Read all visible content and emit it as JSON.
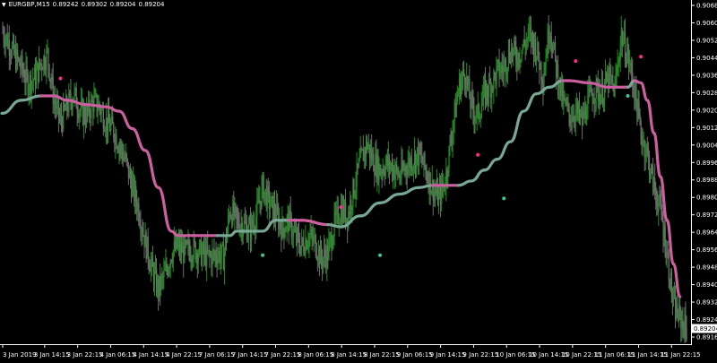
{
  "header": {
    "caret": "▼",
    "symbol": "EURGBP,M15",
    "o": "0.89242",
    "h": "0.89302",
    "l": "0.89204",
    "c": "0.89204"
  },
  "colors": {
    "background": "#000000",
    "axis": "#ffffff",
    "bull": "#228b22",
    "bear": "#6e6e6e",
    "ma_down": "#cc5fa0",
    "ma_up": "#77a894",
    "dot_sell": "#ff2d8a",
    "dot_buy": "#3cc98c"
  },
  "chart_data": {
    "type": "line",
    "title": "EURGBP,M15",
    "ylim": [
      0.89165,
      0.90685
    ],
    "y_ticks": [
      "0.90685",
      "0.90605",
      "0.90525",
      "0.90445",
      "0.90365",
      "0.90285",
      "0.90205",
      "0.90125",
      "0.90045",
      "0.89965",
      "0.89885",
      "0.89805",
      "0.89725",
      "0.89645",
      "0.89565",
      "0.89485",
      "0.89405",
      "0.89325",
      "0.89245",
      "0.89165"
    ],
    "x_ticks": [
      "3 Jan 2019",
      "3 Jan 14:15",
      "3 Jan 22:15",
      "4 Jan 06:15",
      "4 Jan 14:15",
      "4 Jan 22:15",
      "7 Jan 06:15",
      "7 Jan 14:15",
      "7 Jan 22:15",
      "8 Jan 06:15",
      "8 Jan 14:15",
      "8 Jan 22:15",
      "9 Jan 06:15",
      "9 Jan 14:15",
      "9 Jan 22:15",
      "10 Jan 06:15",
      "10 Jan 14:15",
      "10 Jan 22:15",
      "11 Jan 06:15",
      "11 Jan 14:15",
      "11 Jan 22:15"
    ],
    "current_price": "0.89204",
    "price_series": [
      {
        "bar": 0,
        "close": 0.9057
      },
      {
        "bar": 1,
        "close": 0.9052
      },
      {
        "bar": 2,
        "close": 0.9045
      },
      {
        "bar": 3,
        "close": 0.904
      },
      {
        "bar": 4,
        "close": 0.9033
      },
      {
        "bar": 5,
        "close": 0.9035
      },
      {
        "bar": 6,
        "close": 0.9042
      },
      {
        "bar": 7,
        "close": 0.9046
      },
      {
        "bar": 8,
        "close": 0.9025
      },
      {
        "bar": 9,
        "close": 0.9015
      },
      {
        "bar": 10,
        "close": 0.9022
      },
      {
        "bar": 11,
        "close": 0.9028
      },
      {
        "bar": 12,
        "close": 0.902
      },
      {
        "bar": 13,
        "close": 0.9018
      },
      {
        "bar": 14,
        "close": 0.9024
      },
      {
        "bar": 15,
        "close": 0.9022
      },
      {
        "bar": 16,
        "close": 0.9015
      },
      {
        "bar": 17,
        "close": 0.9012
      },
      {
        "bar": 18,
        "close": 0.9005
      },
      {
        "bar": 19,
        "close": 0.8997
      },
      {
        "bar": 20,
        "close": 0.8985
      },
      {
        "bar": 21,
        "close": 0.8975
      },
      {
        "bar": 22,
        "close": 0.896
      },
      {
        "bar": 23,
        "close": 0.8948
      },
      {
        "bar": 24,
        "close": 0.8938
      },
      {
        "bar": 25,
        "close": 0.8945
      },
      {
        "bar": 26,
        "close": 0.8955
      },
      {
        "bar": 27,
        "close": 0.8958
      },
      {
        "bar": 28,
        "close": 0.8955
      },
      {
        "bar": 29,
        "close": 0.8957
      },
      {
        "bar": 30,
        "close": 0.8956
      },
      {
        "bar": 31,
        "close": 0.8954
      },
      {
        "bar": 32,
        "close": 0.8953
      },
      {
        "bar": 33,
        "close": 0.8955
      },
      {
        "bar": 34,
        "close": 0.8953
      },
      {
        "bar": 35,
        "close": 0.8975
      },
      {
        "bar": 36,
        "close": 0.897
      },
      {
        "bar": 37,
        "close": 0.8968
      },
      {
        "bar": 38,
        "close": 0.8965
      },
      {
        "bar": 39,
        "close": 0.8972
      },
      {
        "bar": 40,
        "close": 0.8985
      },
      {
        "bar": 41,
        "close": 0.8978
      },
      {
        "bar": 42,
        "close": 0.8973
      },
      {
        "bar": 43,
        "close": 0.8966
      },
      {
        "bar": 44,
        "close": 0.897
      },
      {
        "bar": 45,
        "close": 0.8962
      },
      {
        "bar": 46,
        "close": 0.8958
      },
      {
        "bar": 47,
        "close": 0.8963
      },
      {
        "bar": 48,
        "close": 0.896
      },
      {
        "bar": 49,
        "close": 0.8952
      },
      {
        "bar": 50,
        "close": 0.8955
      },
      {
        "bar": 51,
        "close": 0.8968
      },
      {
        "bar": 52,
        "close": 0.8975
      },
      {
        "bar": 53,
        "close": 0.8972
      },
      {
        "bar": 54,
        "close": 0.8985
      },
      {
        "bar": 55,
        "close": 0.8997
      },
      {
        "bar": 56,
        "close": 0.9005
      },
      {
        "bar": 57,
        "close": 0.8997
      },
      {
        "bar": 58,
        "close": 0.8993
      },
      {
        "bar": 59,
        "close": 0.8996
      },
      {
        "bar": 60,
        "close": 0.8994
      },
      {
        "bar": 61,
        "close": 0.899
      },
      {
        "bar": 62,
        "close": 0.8995
      },
      {
        "bar": 63,
        "close": 0.8998
      },
      {
        "bar": 64,
        "close": 0.9
      },
      {
        "bar": 65,
        "close": 0.8993
      },
      {
        "bar": 66,
        "close": 0.8985
      },
      {
        "bar": 67,
        "close": 0.898
      },
      {
        "bar": 68,
        "close": 0.8988
      },
      {
        "bar": 69,
        "close": 0.901
      },
      {
        "bar": 70,
        "close": 0.903
      },
      {
        "bar": 71,
        "close": 0.9038
      },
      {
        "bar": 72,
        "close": 0.9022
      },
      {
        "bar": 73,
        "close": 0.9018
      },
      {
        "bar": 74,
        "close": 0.9028
      },
      {
        "bar": 75,
        "close": 0.9032
      },
      {
        "bar": 76,
        "close": 0.9038
      },
      {
        "bar": 77,
        "close": 0.904
      },
      {
        "bar": 78,
        "close": 0.9048
      },
      {
        "bar": 79,
        "close": 0.9045
      },
      {
        "bar": 80,
        "close": 0.905
      },
      {
        "bar": 81,
        "close": 0.9055
      },
      {
        "bar": 82,
        "close": 0.9048
      },
      {
        "bar": 83,
        "close": 0.9035
      },
      {
        "bar": 84,
        "close": 0.906
      },
      {
        "bar": 85,
        "close": 0.904
      },
      {
        "bar": 86,
        "close": 0.9025
      },
      {
        "bar": 87,
        "close": 0.9018
      },
      {
        "bar": 88,
        "close": 0.902
      },
      {
        "bar": 89,
        "close": 0.9015
      },
      {
        "bar": 90,
        "close": 0.9025
      },
      {
        "bar": 91,
        "close": 0.903
      },
      {
        "bar": 92,
        "close": 0.9028
      },
      {
        "bar": 93,
        "close": 0.9035
      },
      {
        "bar": 94,
        "close": 0.903
      },
      {
        "bar": 95,
        "close": 0.9055
      },
      {
        "bar": 96,
        "close": 0.9045
      },
      {
        "bar": 97,
        "close": 0.903
      },
      {
        "bar": 98,
        "close": 0.901
      },
      {
        "bar": 99,
        "close": 0.9
      },
      {
        "bar": 100,
        "close": 0.8985
      },
      {
        "bar": 101,
        "close": 0.8975
      },
      {
        "bar": 102,
        "close": 0.8955
      },
      {
        "bar": 103,
        "close": 0.893
      },
      {
        "bar": 104,
        "close": 0.8925
      },
      {
        "bar": 105,
        "close": 0.892
      }
    ],
    "series": [
      {
        "values": [
          {
            "bar": 0,
            "value": 0.9019,
            "trend": "up"
          },
          {
            "bar": 3,
            "value": 0.9025,
            "trend": "up"
          },
          {
            "bar": 6,
            "value": 0.9027,
            "trend": "up"
          },
          {
            "bar": 8,
            "value": 0.9027,
            "trend": "down"
          },
          {
            "bar": 10,
            "value": 0.9025,
            "trend": "down"
          },
          {
            "bar": 13,
            "value": 0.9023,
            "trend": "down"
          },
          {
            "bar": 16,
            "value": 0.9022,
            "trend": "down"
          },
          {
            "bar": 18,
            "value": 0.902,
            "trend": "down"
          },
          {
            "bar": 20,
            "value": 0.9012,
            "trend": "down"
          },
          {
            "bar": 22,
            "value": 0.9002,
            "trend": "down"
          },
          {
            "bar": 24,
            "value": 0.8985,
            "trend": "down"
          },
          {
            "bar": 26,
            "value": 0.8965,
            "trend": "down"
          },
          {
            "bar": 27,
            "value": 0.8963,
            "trend": "down"
          },
          {
            "bar": 33,
            "value": 0.8963,
            "trend": "down"
          },
          {
            "bar": 35,
            "value": 0.8963,
            "trend": "up"
          },
          {
            "bar": 36,
            "value": 0.8965,
            "trend": "up"
          },
          {
            "bar": 40,
            "value": 0.8965,
            "trend": "up"
          },
          {
            "bar": 42,
            "value": 0.897,
            "trend": "up"
          },
          {
            "bar": 44,
            "value": 0.897,
            "trend": "up"
          },
          {
            "bar": 46,
            "value": 0.897,
            "trend": "down"
          },
          {
            "bar": 50,
            "value": 0.8968,
            "trend": "down"
          },
          {
            "bar": 52,
            "value": 0.8967,
            "trend": "up"
          },
          {
            "bar": 55,
            "value": 0.8972,
            "trend": "up"
          },
          {
            "bar": 58,
            "value": 0.8978,
            "trend": "up"
          },
          {
            "bar": 61,
            "value": 0.8982,
            "trend": "up"
          },
          {
            "bar": 64,
            "value": 0.8985,
            "trend": "up"
          },
          {
            "bar": 66,
            "value": 0.8986,
            "trend": "up"
          },
          {
            "bar": 67,
            "value": 0.8986,
            "trend": "down"
          },
          {
            "bar": 70,
            "value": 0.8986,
            "trend": "down"
          },
          {
            "bar": 72,
            "value": 0.8988,
            "trend": "up"
          },
          {
            "bar": 74,
            "value": 0.8993,
            "trend": "up"
          },
          {
            "bar": 76,
            "value": 0.8998,
            "trend": "up"
          },
          {
            "bar": 78,
            "value": 0.9006,
            "trend": "up"
          },
          {
            "bar": 80,
            "value": 0.902,
            "trend": "up"
          },
          {
            "bar": 82,
            "value": 0.9028,
            "trend": "up"
          },
          {
            "bar": 84,
            "value": 0.9031,
            "trend": "up"
          },
          {
            "bar": 86,
            "value": 0.9034,
            "trend": "up"
          },
          {
            "bar": 87,
            "value": 0.9034,
            "trend": "down"
          },
          {
            "bar": 90,
            "value": 0.9033,
            "trend": "down"
          },
          {
            "bar": 93,
            "value": 0.9031,
            "trend": "down"
          },
          {
            "bar": 96,
            "value": 0.9031,
            "trend": "down"
          },
          {
            "bar": 97,
            "value": 0.9034,
            "trend": "up"
          },
          {
            "bar": 98,
            "value": 0.9033,
            "trend": "down"
          },
          {
            "bar": 99,
            "value": 0.9025,
            "trend": "down"
          },
          {
            "bar": 100,
            "value": 0.901,
            "trend": "down"
          },
          {
            "bar": 101,
            "value": 0.899,
            "trend": "down"
          },
          {
            "bar": 102,
            "value": 0.897,
            "trend": "down"
          },
          {
            "bar": 103,
            "value": 0.895,
            "trend": "down"
          },
          {
            "bar": 104,
            "value": 0.8935,
            "trend": "down"
          }
        ]
      }
    ],
    "signals": [
      {
        "bar": 9,
        "value": 0.9035,
        "kind": "sell"
      },
      {
        "bar": 40,
        "value": 0.8954,
        "kind": "buy"
      },
      {
        "bar": 52,
        "value": 0.8976,
        "kind": "sell"
      },
      {
        "bar": 58,
        "value": 0.8954,
        "kind": "buy"
      },
      {
        "bar": 73,
        "value": 0.9,
        "kind": "sell"
      },
      {
        "bar": 77,
        "value": 0.898,
        "kind": "buy"
      },
      {
        "bar": 88,
        "value": 0.9043,
        "kind": "sell"
      },
      {
        "bar": 96,
        "value": 0.9027,
        "kind": "buy"
      },
      {
        "bar": 98,
        "value": 0.9045,
        "kind": "sell"
      }
    ],
    "grid": false,
    "legend": "none"
  }
}
